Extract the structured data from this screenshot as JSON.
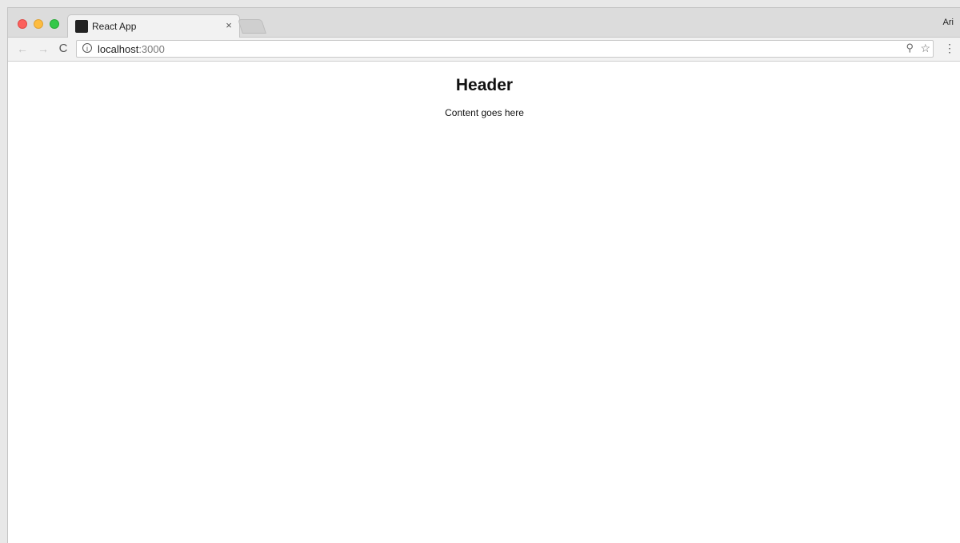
{
  "browser": {
    "tab_title": "React App",
    "close_glyph": "×",
    "profile_name": "Ari",
    "url_host": "localhost",
    "url_port": ":3000",
    "icons": {
      "back": "←",
      "forward": "→",
      "reload": "C",
      "info": "i",
      "zoom": "⚲",
      "star": "☆",
      "menu": "⋮"
    }
  },
  "page": {
    "header": "Header",
    "content": "Content goes here"
  }
}
